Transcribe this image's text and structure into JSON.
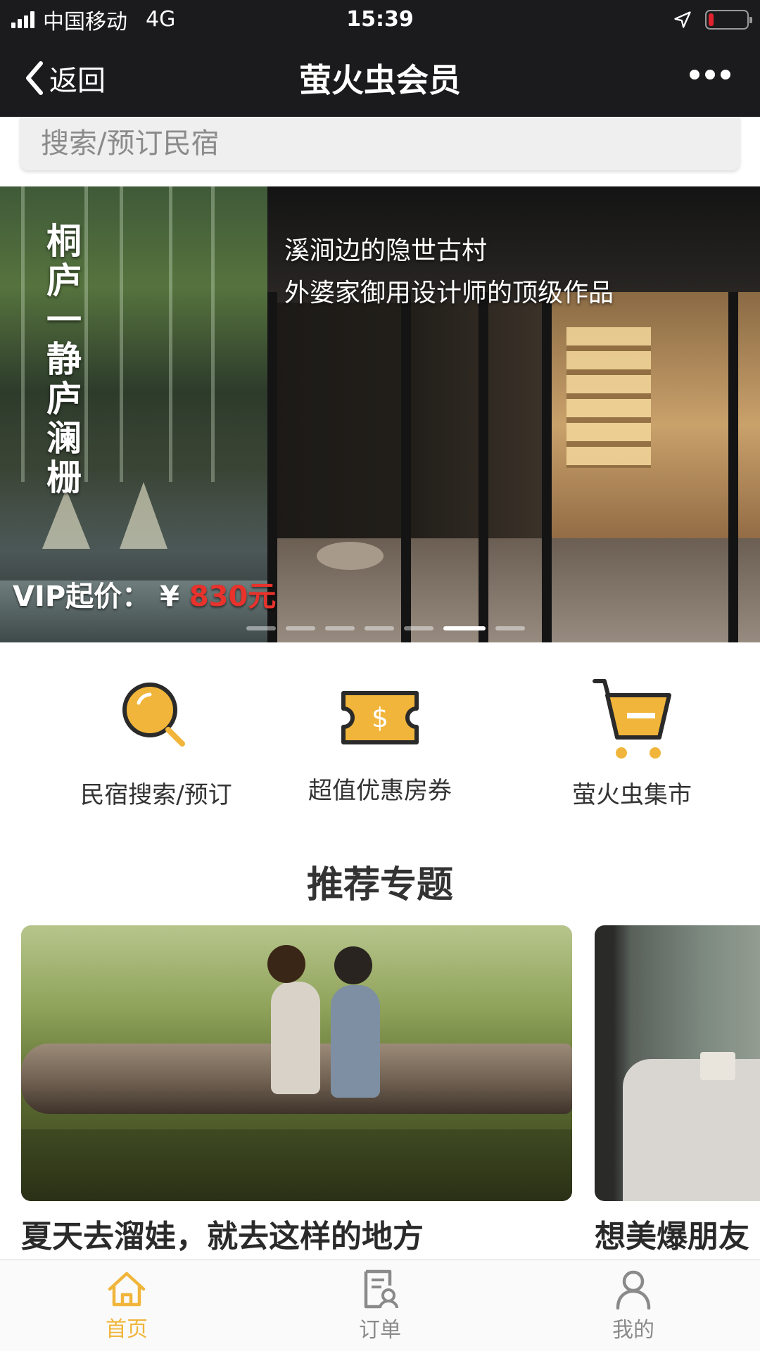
{
  "status_bar": {
    "carrier": "中国移动",
    "network": "4G",
    "time": "15:39"
  },
  "nav": {
    "back_label": "返回",
    "title": "萤火虫会员"
  },
  "search": {
    "placeholder": "搜索/预订民宿"
  },
  "banner": {
    "side_title": "桐庐一静庐澜栅",
    "tagline_1": "溪涧边的隐世古村",
    "tagline_2": "外婆家御用设计师的顶级作品",
    "price_prefix": "VIP起价： ¥ ",
    "price_value": "830元",
    "slide_count": 7,
    "active_slide": 5
  },
  "quick_actions": [
    {
      "label": "民宿搜索/预订",
      "icon": "search-icon"
    },
    {
      "label": "超值优惠房券",
      "icon": "coupon-icon"
    },
    {
      "label": "萤火虫集市",
      "icon": "cart-icon"
    }
  ],
  "section": {
    "title": "推荐专题"
  },
  "cards": [
    {
      "title": "夏天去溜娃，就去这样的地方"
    },
    {
      "title": "想美爆朋友"
    }
  ],
  "tabs": [
    {
      "label": "首页",
      "icon": "home-icon",
      "active": true
    },
    {
      "label": "订单",
      "icon": "order-icon",
      "active": false
    },
    {
      "label": "我的",
      "icon": "profile-icon",
      "active": false
    }
  ],
  "colors": {
    "accent": "#f0b53a",
    "nav_bg": "#1b1b1d",
    "price_red": "#e8322c"
  }
}
